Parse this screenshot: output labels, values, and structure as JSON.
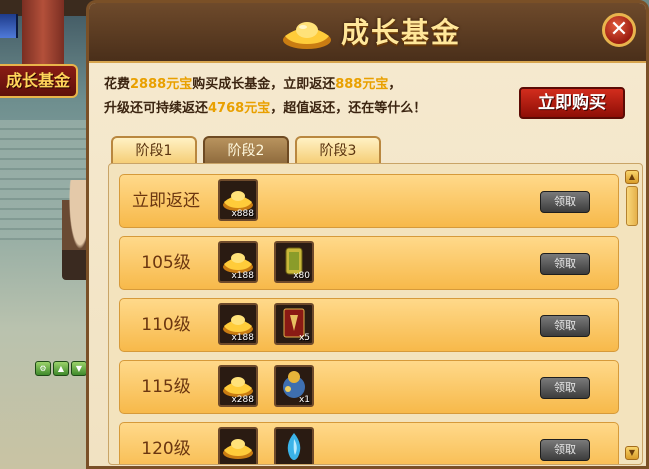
{
  "side_tab": {
    "label": "成长基金"
  },
  "panel": {
    "title": "成长基金",
    "close_label": "✕",
    "intro_line1": {
      "p1": "花费",
      "h1": "2888元宝",
      "p2": "购买成长基金，立即返还",
      "h2": "888元宝",
      "p3": "，"
    },
    "intro_line2": {
      "p1": "升级还可持续返还",
      "h1": "4768元宝",
      "p2": "，超值返还，还在等什么！"
    },
    "buy_button": "立即购买",
    "tabs": [
      {
        "label": "阶段1",
        "active": false
      },
      {
        "label": "阶段2",
        "active": true
      },
      {
        "label": "阶段3",
        "active": false
      }
    ],
    "rows": [
      {
        "label": "立即返还",
        "items": [
          {
            "icon": "gold-ingot-icon",
            "count": "x888"
          }
        ],
        "claim": "领取"
      },
      {
        "label": "105级",
        "items": [
          {
            "icon": "gold-ingot-icon",
            "count": "x188"
          },
          {
            "icon": "jade-token-icon",
            "count": "x80"
          }
        ],
        "claim": "领取"
      },
      {
        "label": "110级",
        "items": [
          {
            "icon": "gold-ingot-icon",
            "count": "x188"
          },
          {
            "icon": "red-scroll-icon",
            "count": "x5"
          }
        ],
        "claim": "领取"
      },
      {
        "label": "115级",
        "items": [
          {
            "icon": "gold-ingot-icon",
            "count": "x288"
          },
          {
            "icon": "treasure-bag-icon",
            "count": "x1"
          }
        ],
        "claim": "领取"
      },
      {
        "label": "120级",
        "items": [
          {
            "icon": "gold-ingot-icon",
            "count": ""
          },
          {
            "icon": "blue-spirit-icon",
            "count": ""
          }
        ],
        "claim": "领取"
      }
    ]
  },
  "colors": {
    "highlight": "#e9a000",
    "header": "#4a2f1a",
    "row": "#f7b94a"
  }
}
